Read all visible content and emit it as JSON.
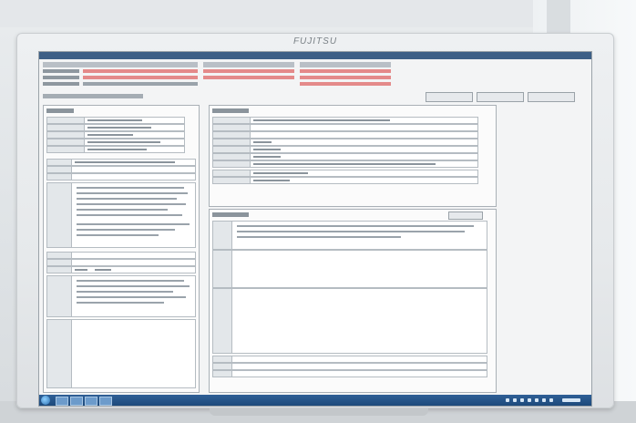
{
  "monitor": {
    "brand": "FUJITSU"
  },
  "app": {
    "window_title": "",
    "toolbar_buttons": [
      "",
      "",
      ""
    ]
  },
  "left_panel": {
    "section_labels": [
      "",
      "",
      ""
    ]
  },
  "right_panel": {
    "section_labels": [
      "",
      ""
    ]
  },
  "colors": {
    "title_bar": "#3d5f86",
    "taskbar": "#1d4a7b",
    "highlight_text": "#e48a8a"
  }
}
